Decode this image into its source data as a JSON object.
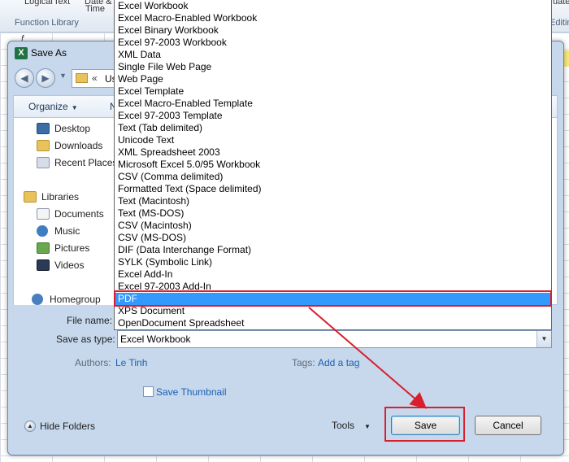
{
  "ribbon": {
    "buttons": [
      "Logical",
      "Text",
      "Date &",
      "Time",
      "uate"
    ],
    "groups": [
      "Function Library",
      "Editin"
    ],
    "fx": "f"
  },
  "dialog": {
    "title": "Save As",
    "address": {
      "chevrons": "«",
      "path": "Us"
    },
    "toolbar": {
      "organize": "Organize",
      "new_folder": "Ne"
    },
    "nav": {
      "favorites": [
        "Desktop",
        "Downloads",
        "Recent Places"
      ],
      "libraries_header": "Libraries",
      "libraries": [
        "Documents",
        "Music",
        "Pictures",
        "Videos"
      ],
      "homegroup": "Homegroup"
    },
    "form": {
      "file_name_label": "File name:",
      "file_name_value": "",
      "save_as_type_label": "Save as type:",
      "save_as_type_value": "Excel Workbook",
      "authors_label": "Authors:",
      "authors_value": "Le Tinh",
      "tags_label": "Tags:",
      "tags_value": "Add a tag",
      "save_thumbnail_label": "Save Thumbnail",
      "save_thumbnail_checked": false
    },
    "footer": {
      "hide_folders": "Hide Folders",
      "tools": "Tools",
      "save": "Save",
      "cancel": "Cancel"
    }
  },
  "dropdown": {
    "items": [
      "Excel Workbook",
      "Excel Macro-Enabled Workbook",
      "Excel Binary Workbook",
      "Excel 97-2003 Workbook",
      "XML Data",
      "Single File Web Page",
      "Web Page",
      "Excel Template",
      "Excel Macro-Enabled Template",
      "Excel 97-2003 Template",
      "Text (Tab delimited)",
      "Unicode Text",
      "XML Spreadsheet 2003",
      "Microsoft Excel 5.0/95 Workbook",
      "CSV (Comma delimited)",
      "Formatted Text (Space delimited)",
      "Text (Macintosh)",
      "Text (MS-DOS)",
      "CSV (Macintosh)",
      "CSV (MS-DOS)",
      "DIF (Data Interchange Format)",
      "SYLK (Symbolic Link)",
      "Excel Add-In",
      "Excel 97-2003 Add-In",
      "PDF",
      "XPS Document",
      "OpenDocument Spreadsheet"
    ],
    "selected_index": 24
  },
  "colors": {
    "highlight": "#3399ff",
    "annotation": "#d91e2c",
    "link": "#1a5fb4"
  }
}
